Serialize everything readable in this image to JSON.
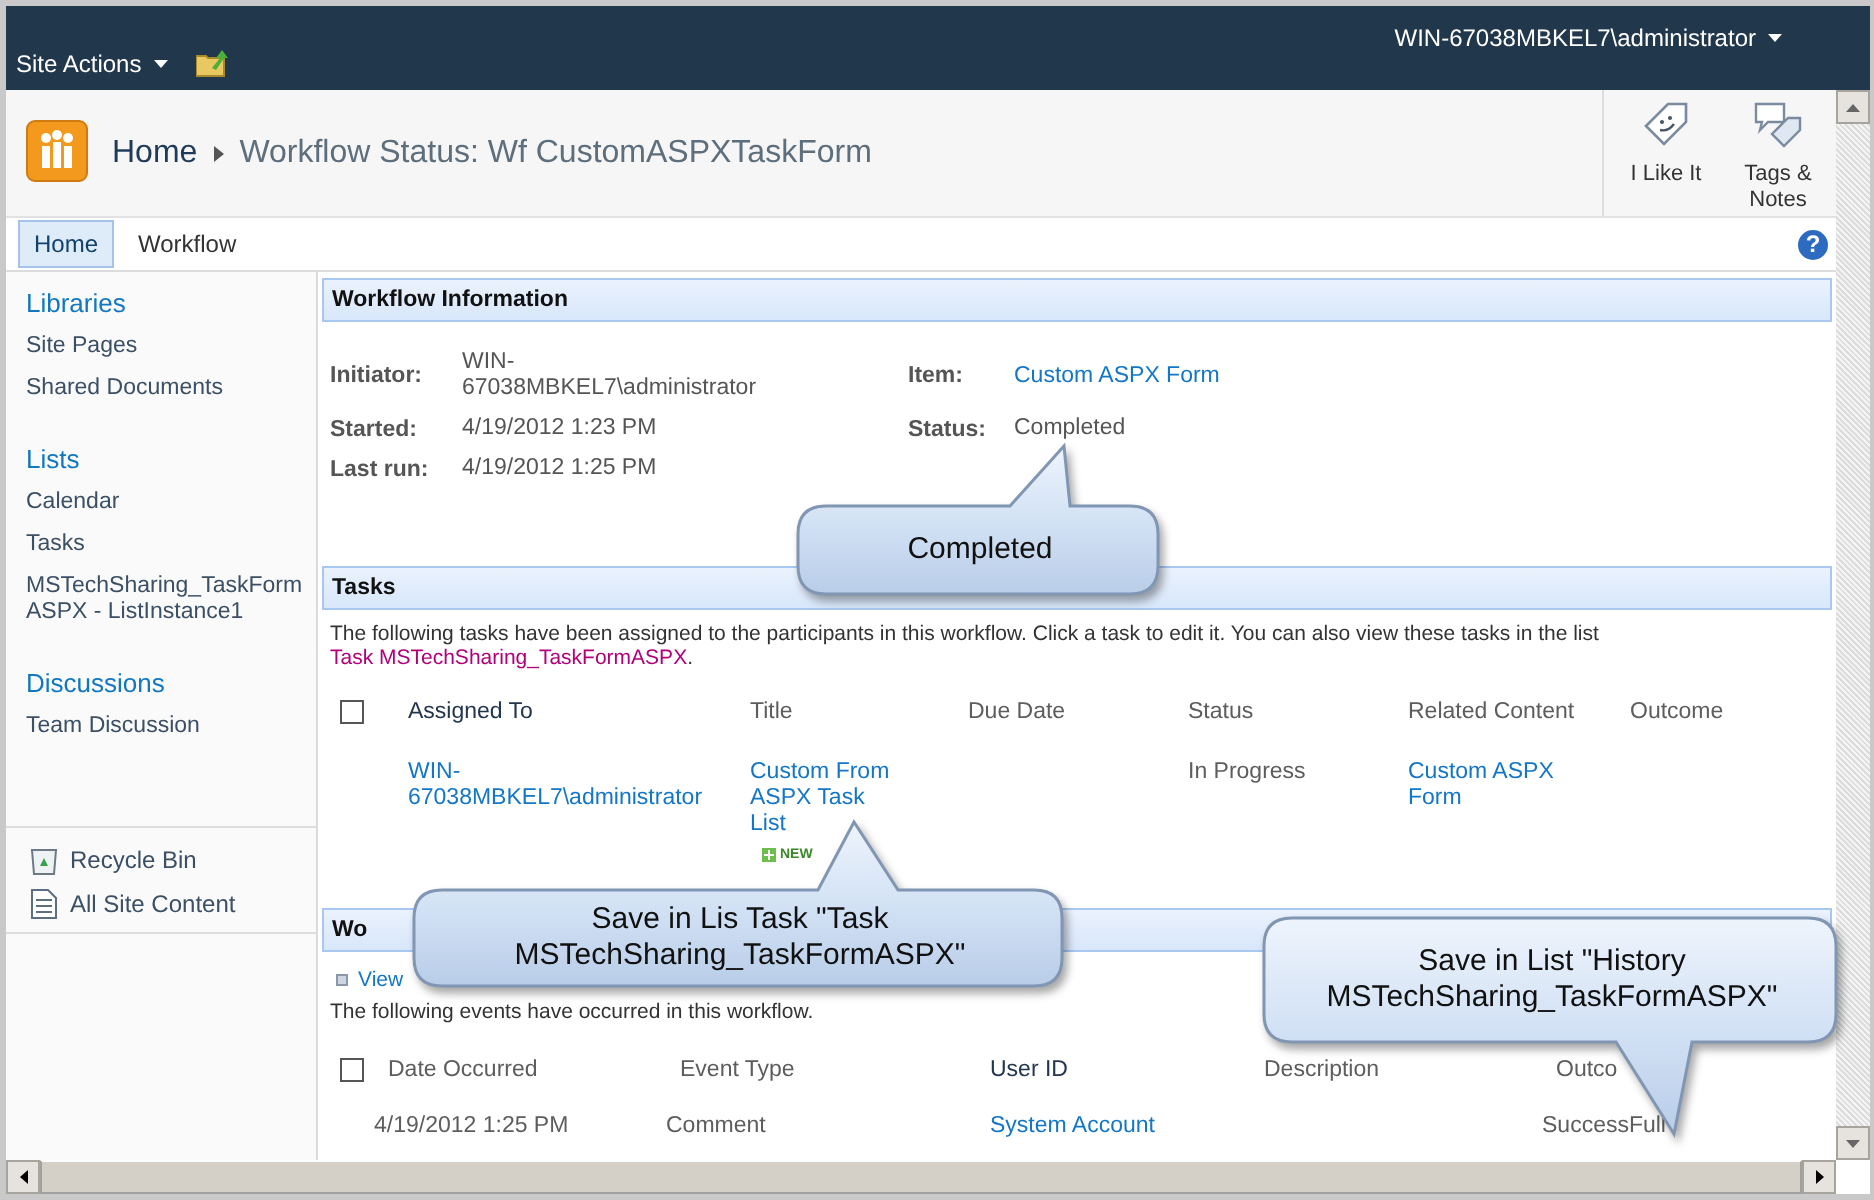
{
  "top_bar": {
    "site_actions": "Site Actions",
    "user": "WIN-67038MBKEL7\\administrator"
  },
  "header": {
    "breadcrumb_home": "Home",
    "title": "Workflow Status: Wf CustomASPXTaskForm",
    "actions": [
      {
        "label": "I Like It",
        "kind": "like"
      },
      {
        "label": "Tags & Notes",
        "kind": "tags"
      }
    ]
  },
  "nav": {
    "tabs": [
      {
        "label": "Home",
        "selected": true
      },
      {
        "label": "Workflow",
        "selected": false
      }
    ],
    "help": "?"
  },
  "sidebar": {
    "sections": [
      {
        "heading": "Libraries",
        "items": [
          "Site Pages",
          "Shared Documents"
        ]
      },
      {
        "heading": "Lists",
        "items": [
          "Calendar",
          "Tasks",
          "MSTechSharing_TaskFormASPX - ListInstance1"
        ]
      },
      {
        "heading": "Discussions",
        "items": [
          "Team Discussion"
        ]
      }
    ],
    "footer_links": [
      {
        "label": "Recycle Bin",
        "kind": "recycle"
      },
      {
        "label": "All Site Content",
        "kind": "content"
      }
    ]
  },
  "workflow_information": {
    "title": "Workflow Information",
    "fields": [
      {
        "label": "Initiator:",
        "value": "WIN-67038MBKEL7\\administrator",
        "kind": "text"
      },
      {
        "label": "Item:",
        "value": "Custom ASPX Form",
        "kind": "link"
      },
      {
        "label": "Started:",
        "value": "4/19/2012 1:23 PM",
        "kind": "text"
      },
      {
        "label": "Status:",
        "value": "Completed",
        "kind": "text"
      },
      {
        "label": "Last run:",
        "value": "4/19/2012 1:25 PM",
        "kind": "text"
      }
    ]
  },
  "tasks": {
    "title": "Tasks",
    "intro": {
      "text": "The following tasks have been assigned to the participants in this workflow. Click a task to edit it. You can also view these tasks in the list ",
      "link": "Task MSTechSharing_TaskFormASPX",
      "end": "."
    },
    "select_all_checked": false,
    "columns": [
      "Assigned To",
      "Title",
      "Due Date",
      "Status",
      "Related Content",
      "Outcome"
    ],
    "rows": [
      {
        "assigned_to": "WIN-67038MBKEL7\\administrator",
        "title": "Custom From ASPX Task List",
        "badge": "NEW",
        "status": "In Progress",
        "related_content": "Custom ASPX Form"
      }
    ]
  },
  "workflow_history": {
    "title": "Wo",
    "reports_link": "View",
    "intro": "The following events have occurred in this workflow.",
    "select_all_checked": false,
    "columns": [
      "Date Occurred",
      "Event Type",
      "User ID",
      "Description",
      "Outco"
    ],
    "rows": [
      {
        "date_occurred": "4/19/2012 1:25 PM",
        "event_type": "Comment",
        "user_id": "System Account",
        "outcome": "SuccessFull"
      }
    ]
  },
  "callouts": [
    {
      "text": "Completed"
    },
    {
      "text": "Save in Lis Task \"Task MSTechSharing_TaskFormASPX\""
    },
    {
      "text": "Save in List \"History MSTechSharing_TaskFormASPX\""
    }
  ]
}
